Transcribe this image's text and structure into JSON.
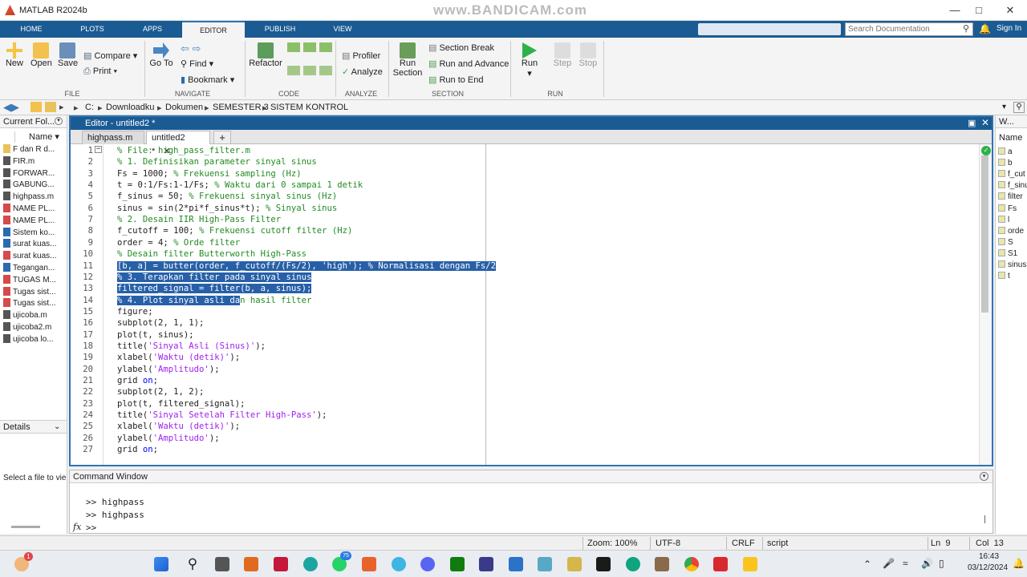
{
  "window": {
    "title": "MATLAB R2024b",
    "watermark": "www.BANDICAM.com"
  },
  "tabs": [
    "HOME",
    "PLOTS",
    "APPS",
    "EDITOR",
    "PUBLISH",
    "VIEW"
  ],
  "search_placeholder": "Search Documentation",
  "signin": "Sign In",
  "ribbon": {
    "file": {
      "new": "New",
      "open": "Open",
      "save": "Save",
      "compare": "Compare",
      "print": "Print",
      "group": "FILE"
    },
    "navigate": {
      "goto": "Go To",
      "find": "Find",
      "bookmark": "Bookmark",
      "group": "NAVIGATE"
    },
    "code": {
      "refactor": "Refactor",
      "group": "CODE"
    },
    "analyze": {
      "profiler": "Profiler",
      "analyze": "Analyze",
      "group": "ANALYZE"
    },
    "section": {
      "run_section": "Run",
      "run_section2": "Section",
      "section_break": "Section Break",
      "run_advance": "Run and Advance",
      "run_end": "Run to End",
      "group": "SECTION"
    },
    "run": {
      "run": "Run",
      "step": "Step",
      "stop": "Stop",
      "group": "RUN"
    }
  },
  "breadcrumb": [
    "C:",
    "Downloadku",
    "Dokumen",
    "SEMESTER 3",
    "SISTEM KONTROL"
  ],
  "current_folder": {
    "title": "Current Fol...",
    "col": "Name",
    "files": [
      "F dan R d...",
      "FIR.m",
      "FORWAR...",
      "GABUNG...",
      "highpass.m",
      "NAME PL...",
      "NAME PL...",
      "Sistem ko...",
      "surat kuas...",
      "surat kuas...",
      "Tegangan...",
      "TUGAS M...",
      "Tugas sist...",
      "Tugas sist...",
      "ujicoba.m",
      "ujicoba2.m",
      "ujicoba lo..."
    ],
    "details": "Details",
    "select_hint": "Select a file to vie"
  },
  "editor": {
    "title": "Editor - untitled2 *",
    "tabs": [
      "highpass.m",
      "untitled2 *"
    ],
    "lines": [
      "% File: high_pass_filter.m",
      "% 1. Definisikan parameter sinyal sinus",
      "Fs = 1000; % Frekuensi sampling (Hz)",
      "t = 0:1/Fs:1-1/Fs; % Waktu dari 0 sampai 1 detik",
      "f_sinus = 50; % Frekuensi sinyal sinus (Hz)",
      "sinus = sin(2*pi*f_sinus*t); % Sinyal sinus",
      "% 2. Desain IIR High-Pass Filter",
      "f_cutoff = 100; % Frekuensi cutoff filter (Hz)",
      "order = 4; % Orde filter",
      "% Desain filter Butterworth High-Pass",
      "[b, a] = butter(order, f_cutoff/(Fs/2), 'high'); % Normalisasi dengan Fs/2",
      "% 3. Terapkan filter pada sinyal sinus",
      "filtered_signal = filter(b, a, sinus);",
      "% 4. Plot sinyal asli dan hasil filter",
      "figure;",
      "subplot(2, 1, 1);",
      "plot(t, sinus);",
      "title('Sinyal Asli (Sinus)');",
      "xlabel('Waktu (detik)');",
      "ylabel('Amplitudo');",
      "grid on;",
      "subplot(2, 1, 2);",
      "plot(t, filtered_signal);",
      "title('Sinyal Setelah Filter High-Pass');",
      "xlabel('Waktu (detik)');",
      "ylabel('Amplitudo');",
      "grid on;"
    ]
  },
  "workspace": {
    "title": "W...",
    "col": "Name",
    "vars": [
      "a",
      "b",
      "f_cut",
      "f_sinu",
      "filter",
      "Fs",
      "l",
      "orde",
      "S",
      "S1",
      "sinus",
      "t"
    ]
  },
  "command": {
    "title": "Command Window",
    "lines": [
      ">> highpass",
      ">> highpass"
    ],
    "prompt": ">>",
    "fx": "fx"
  },
  "status": {
    "zoom": "Zoom: 100%",
    "enc": "UTF-8",
    "eol": "CRLF",
    "type": "script",
    "ln": "Ln  9",
    "col": "Col  13"
  },
  "taskbar": {
    "time": "16:43",
    "date": "03/12/2024",
    "badge": "75",
    "notif": "1"
  }
}
